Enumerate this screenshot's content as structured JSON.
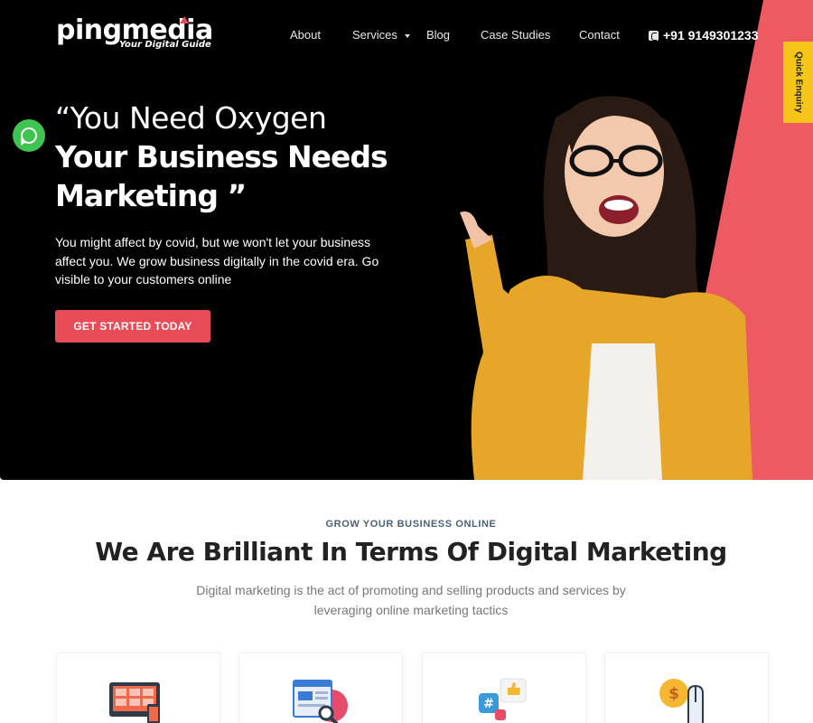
{
  "brand": {
    "name": "pingmedia",
    "tagline": "Your Digital Guide"
  },
  "nav": {
    "items": [
      {
        "label": "About"
      },
      {
        "label": "Services",
        "has_dropdown": true
      },
      {
        "label": "Blog"
      },
      {
        "label": "Case Studies"
      },
      {
        "label": "Contact"
      }
    ],
    "phone": "+91 9149301233"
  },
  "quick_enquiry": "Quick Enquiry",
  "hero": {
    "heading_line1": "“You Need Oxygen",
    "heading_line2": "Your Business Needs",
    "heading_line3": "Marketing ”",
    "paragraph": "You might affect by covid, but we won't let your business affect you. We grow business digitally in the covid era. Go visible to your customers online",
    "cta_label": "GET STARTED TODAY"
  },
  "section": {
    "eyebrow": "GROW YOUR BUSINESS ONLINE",
    "title": "We Are Brilliant In Terms Of Digital Marketing",
    "subtitle": "Digital marketing is the act of promoting and selling products and services by leveraging online marketing tactics"
  },
  "service_cards": [
    {
      "icon": "web-design-icon"
    },
    {
      "icon": "seo-analytics-icon"
    },
    {
      "icon": "social-media-icon"
    },
    {
      "icon": "ppc-icon"
    }
  ],
  "colors": {
    "accent": "#e84c57",
    "quick_enquiry": "#f5c518",
    "whatsapp": "#3fc351",
    "hero_bg": "#000000"
  }
}
